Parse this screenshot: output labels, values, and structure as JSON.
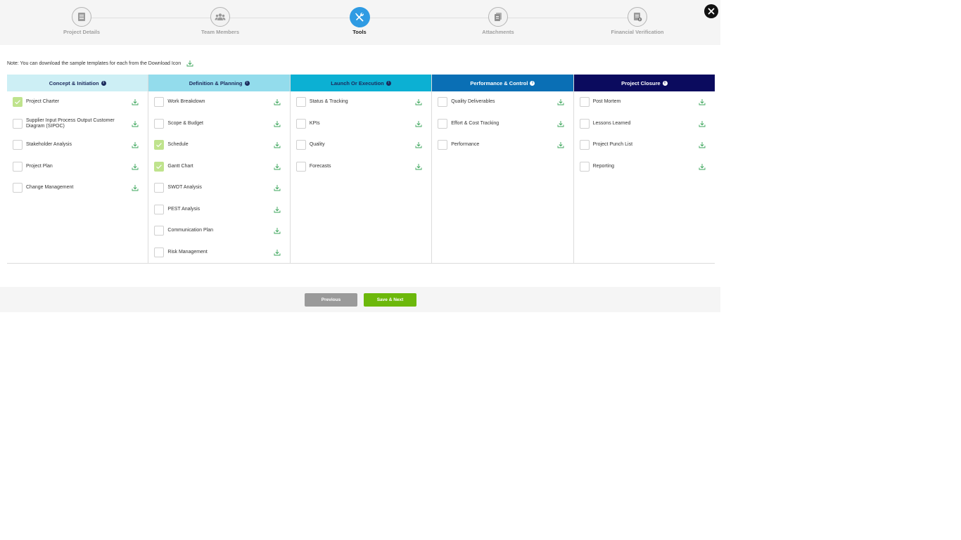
{
  "stepper": {
    "steps": [
      {
        "label": "Project Details",
        "icon": "document-icon"
      },
      {
        "label": "Team Members",
        "icon": "team-icon"
      },
      {
        "label": "Tools",
        "icon": "tools-icon",
        "active": true
      },
      {
        "label": "Attachments",
        "icon": "attachments-icon"
      },
      {
        "label": "Financial Verification",
        "icon": "financial-document-icon"
      }
    ]
  },
  "note": "Note: You can download the sample templates for each from the Download Icon",
  "phases": [
    {
      "title": "Concept & Initiation",
      "bg": "#cdeff5",
      "fg": "#1c2a5c",
      "items": [
        {
          "label": "Project Charter",
          "checked": true
        },
        {
          "label": "Supplier Input Process Output Customer Diagram (SIPOC)",
          "checked": false
        },
        {
          "label": "Stakeholder Analysis",
          "checked": false
        },
        {
          "label": "Project Plan",
          "checked": false
        },
        {
          "label": "Change Management",
          "checked": false
        }
      ]
    },
    {
      "title": "Definition & Planning",
      "bg": "#93dcec",
      "fg": "#1c2a5c",
      "items": [
        {
          "label": "Work Breakdown",
          "checked": false
        },
        {
          "label": "Scope & Budget",
          "checked": false
        },
        {
          "label": "Schedule",
          "checked": true
        },
        {
          "label": "Gantt Chart",
          "checked": true
        },
        {
          "label": "SWOT Analysis",
          "checked": false
        },
        {
          "label": "PEST Analysis",
          "checked": false
        },
        {
          "label": "Communication Plan",
          "checked": false
        },
        {
          "label": "Risk Management",
          "checked": false
        }
      ]
    },
    {
      "title": "Launch Or Execution",
      "bg": "#0cb0d3",
      "fg": "#1c2a5c",
      "items": [
        {
          "label": "Status & Tracking",
          "checked": false
        },
        {
          "label": "KPIs",
          "checked": false
        },
        {
          "label": "Quality",
          "checked": false
        },
        {
          "label": "Forecasts",
          "checked": false
        }
      ]
    },
    {
      "title": "Performance & Control",
      "bg": "#0a6fb5",
      "fg": "#ffffff",
      "items": [
        {
          "label": "Quality Deliverables",
          "checked": false
        },
        {
          "label": "Effort & Cost Tracking",
          "checked": false
        },
        {
          "label": "Performance",
          "checked": false
        }
      ]
    },
    {
      "title": "Project Closure",
      "bg": "#0b0b5e",
      "fg": "#ffffff",
      "items": [
        {
          "label": "Post Mortem",
          "checked": false
        },
        {
          "label": "Lessons Learned",
          "checked": false
        },
        {
          "label": "Project Punch List",
          "checked": false
        },
        {
          "label": "Reporting",
          "checked": false
        }
      ]
    }
  ],
  "footer": {
    "previous_label": "Previous",
    "next_label": "Save & Next"
  },
  "colors": {
    "accent": "#2f9be3",
    "check": "#bfe38d",
    "download": "#3aa55a",
    "next": "#6cb80b",
    "prev": "#9a9a9a"
  }
}
